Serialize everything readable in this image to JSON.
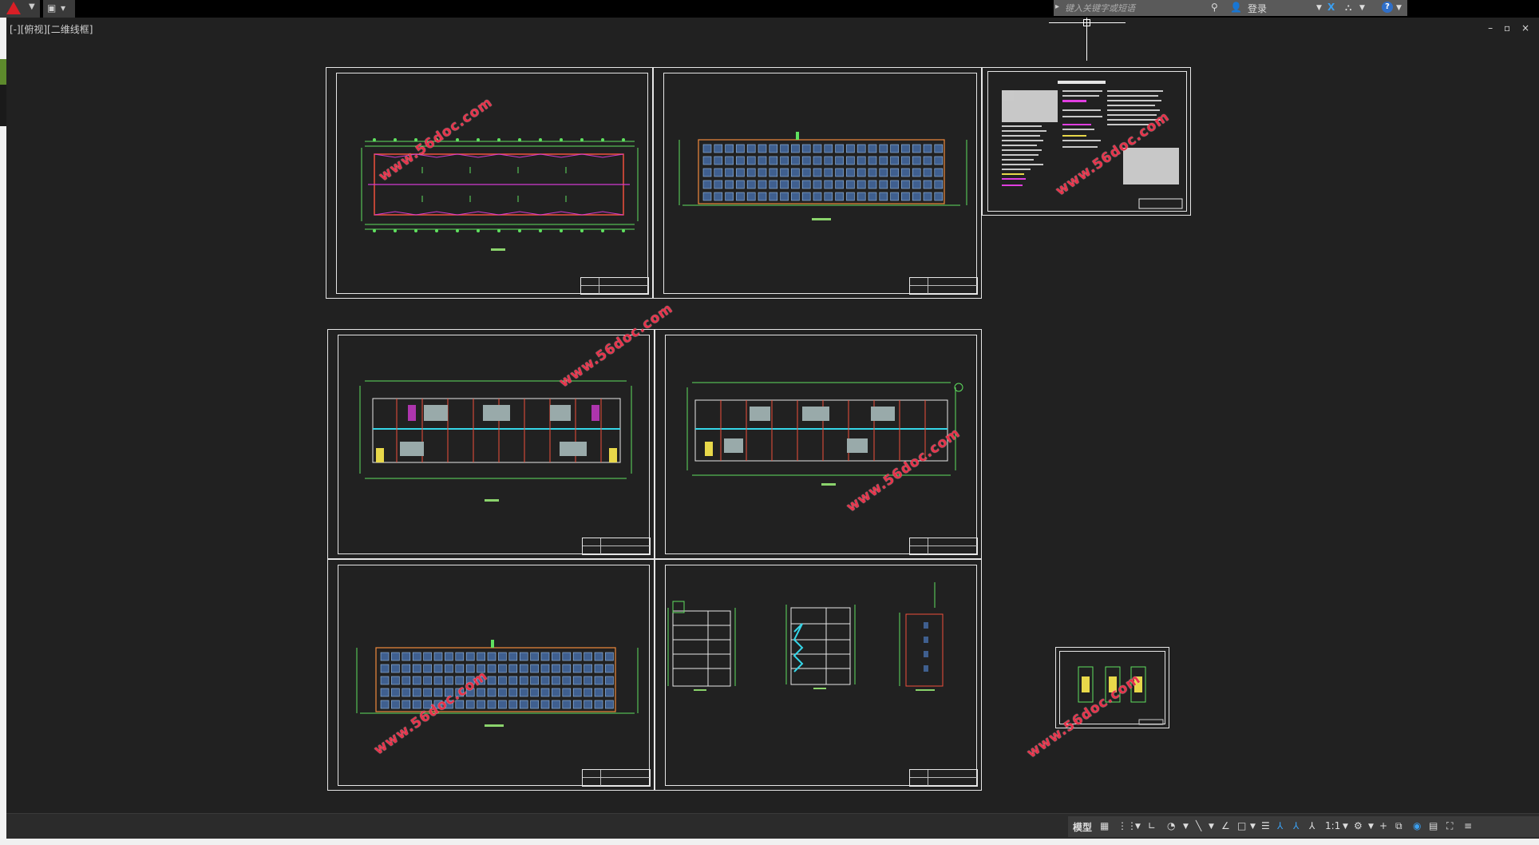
{
  "titlebar": {
    "app_menu_icon": "autocad-logo-icon",
    "search_placeholder": "键入关键字或短语",
    "login_label": "登录",
    "help_label": "?"
  },
  "viewport": {
    "label": "[-][俯视][二维线框]"
  },
  "window_controls": [
    "–",
    "▫",
    "×"
  ],
  "sheets": {
    "watermark": "www.56doc.com",
    "notes_title": "建筑设计总说明"
  },
  "statusbar": {
    "model_tab": "模型",
    "scale": "1:1",
    "icons": [
      "grid-icon",
      "snap-icon",
      "ortho-icon",
      "polar-icon",
      "osnap-icon",
      "otrack-icon",
      "lineweight-icon",
      "annotation-icon",
      "workspace-icon",
      "gear-icon",
      "plus-icon",
      "isolate-icon",
      "hardware-accel-icon",
      "fullscreen-icon",
      "customize-icon"
    ]
  }
}
